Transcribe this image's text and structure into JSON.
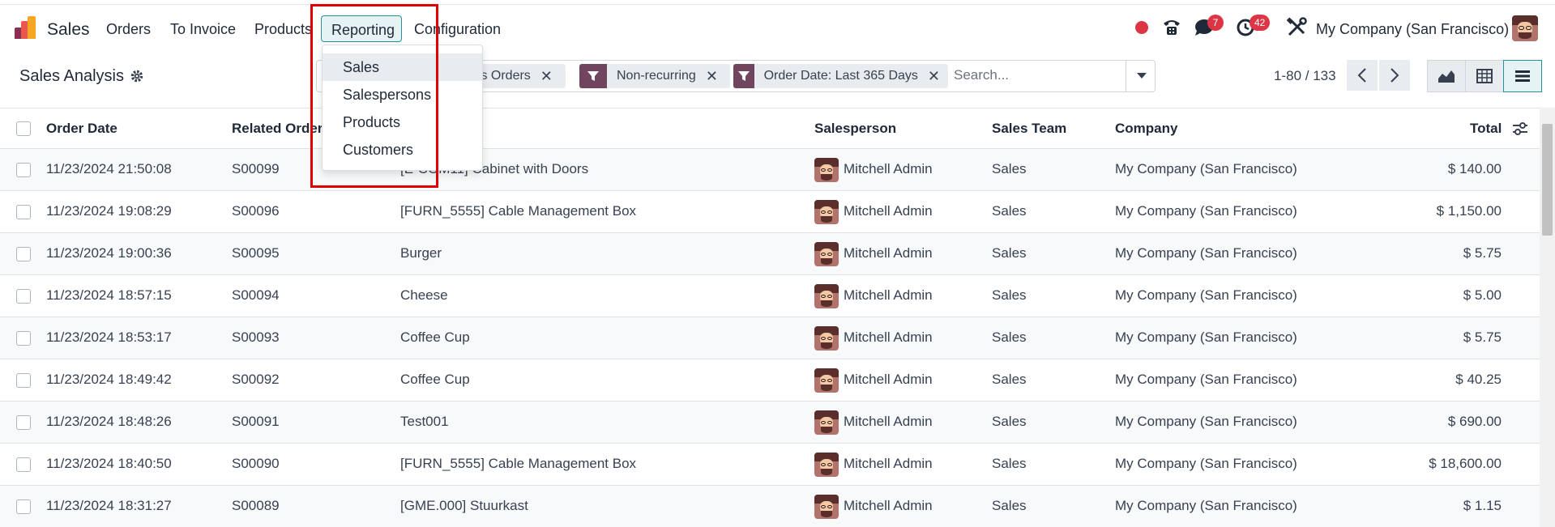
{
  "navbar": {
    "app_name": "Sales",
    "menu": {
      "orders": "Orders",
      "to_invoice": "To Invoice",
      "products": "Products",
      "reporting": "Reporting",
      "configuration": "Configuration"
    },
    "messages_badge": "7",
    "activities_badge": "42",
    "company": "My Company (San Francisco)",
    "icons": [
      "record-dot",
      "phone-icon",
      "chat-icon",
      "clock-icon",
      "tools-icon",
      "avatar"
    ]
  },
  "reporting_dropdown": {
    "items": [
      "Sales",
      "Salespersons",
      "Products",
      "Customers"
    ],
    "hovered": "Sales"
  },
  "control": {
    "title": "Sales Analysis",
    "facets": [
      "les Orders",
      "Non-recurring",
      "Order Date: Last 365 Days"
    ],
    "search_placeholder": "Search...",
    "pager": "1-80 / 133",
    "views": [
      "graph-view",
      "pivot-view",
      "list-view"
    ],
    "active_view": "list-view"
  },
  "table": {
    "columns": {
      "order_date": "Order Date",
      "related_order": "Related Order",
      "salesperson": "Salesperson",
      "sales_team": "Sales Team",
      "company": "Company",
      "total": "Total"
    },
    "rows": [
      {
        "date": "11/23/2024 21:50:08",
        "order": "S00099",
        "product": "[E-COM11] Cabinet with Doors",
        "salesperson": "Mitchell Admin",
        "team": "Sales",
        "company": "My Company (San Francisco)",
        "total": "$ 140.00"
      },
      {
        "date": "11/23/2024 19:08:29",
        "order": "S00096",
        "product": "[FURN_5555] Cable Management Box",
        "salesperson": "Mitchell Admin",
        "team": "Sales",
        "company": "My Company (San Francisco)",
        "total": "$ 1,150.00"
      },
      {
        "date": "11/23/2024 19:00:36",
        "order": "S00095",
        "product": "Burger",
        "salesperson": "Mitchell Admin",
        "team": "Sales",
        "company": "My Company (San Francisco)",
        "total": "$ 5.75"
      },
      {
        "date": "11/23/2024 18:57:15",
        "order": "S00094",
        "product": "Cheese",
        "salesperson": "Mitchell Admin",
        "team": "Sales",
        "company": "My Company (San Francisco)",
        "total": "$ 5.00"
      },
      {
        "date": "11/23/2024 18:53:17",
        "order": "S00093",
        "product": "Coffee Cup",
        "salesperson": "Mitchell Admin",
        "team": "Sales",
        "company": "My Company (San Francisco)",
        "total": "$ 5.75"
      },
      {
        "date": "11/23/2024 18:49:42",
        "order": "S00092",
        "product": "Coffee Cup",
        "salesperson": "Mitchell Admin",
        "team": "Sales",
        "company": "My Company (San Francisco)",
        "total": "$ 40.25"
      },
      {
        "date": "11/23/2024 18:48:26",
        "order": "S00091",
        "product": "Test001",
        "salesperson": "Mitchell Admin",
        "team": "Sales",
        "company": "My Company (San Francisco)",
        "total": "$ 690.00"
      },
      {
        "date": "11/23/2024 18:40:50",
        "order": "S00090",
        "product": "[FURN_5555] Cable Management Box",
        "salesperson": "Mitchell Admin",
        "team": "Sales",
        "company": "My Company (San Francisco)",
        "total": "$ 18,600.00"
      },
      {
        "date": "11/23/2024 18:31:27",
        "order": "S00089",
        "product": "[GME.000] Stuurkast",
        "salesperson": "Mitchell Admin",
        "team": "Sales",
        "company": "My Company (San Francisco)",
        "total": "$ 1.15"
      }
    ]
  },
  "colors": {
    "accent": "#2b8f9a",
    "facet_icon": "#71455e",
    "badge": "#dc3545",
    "highlight": "#e00000"
  }
}
